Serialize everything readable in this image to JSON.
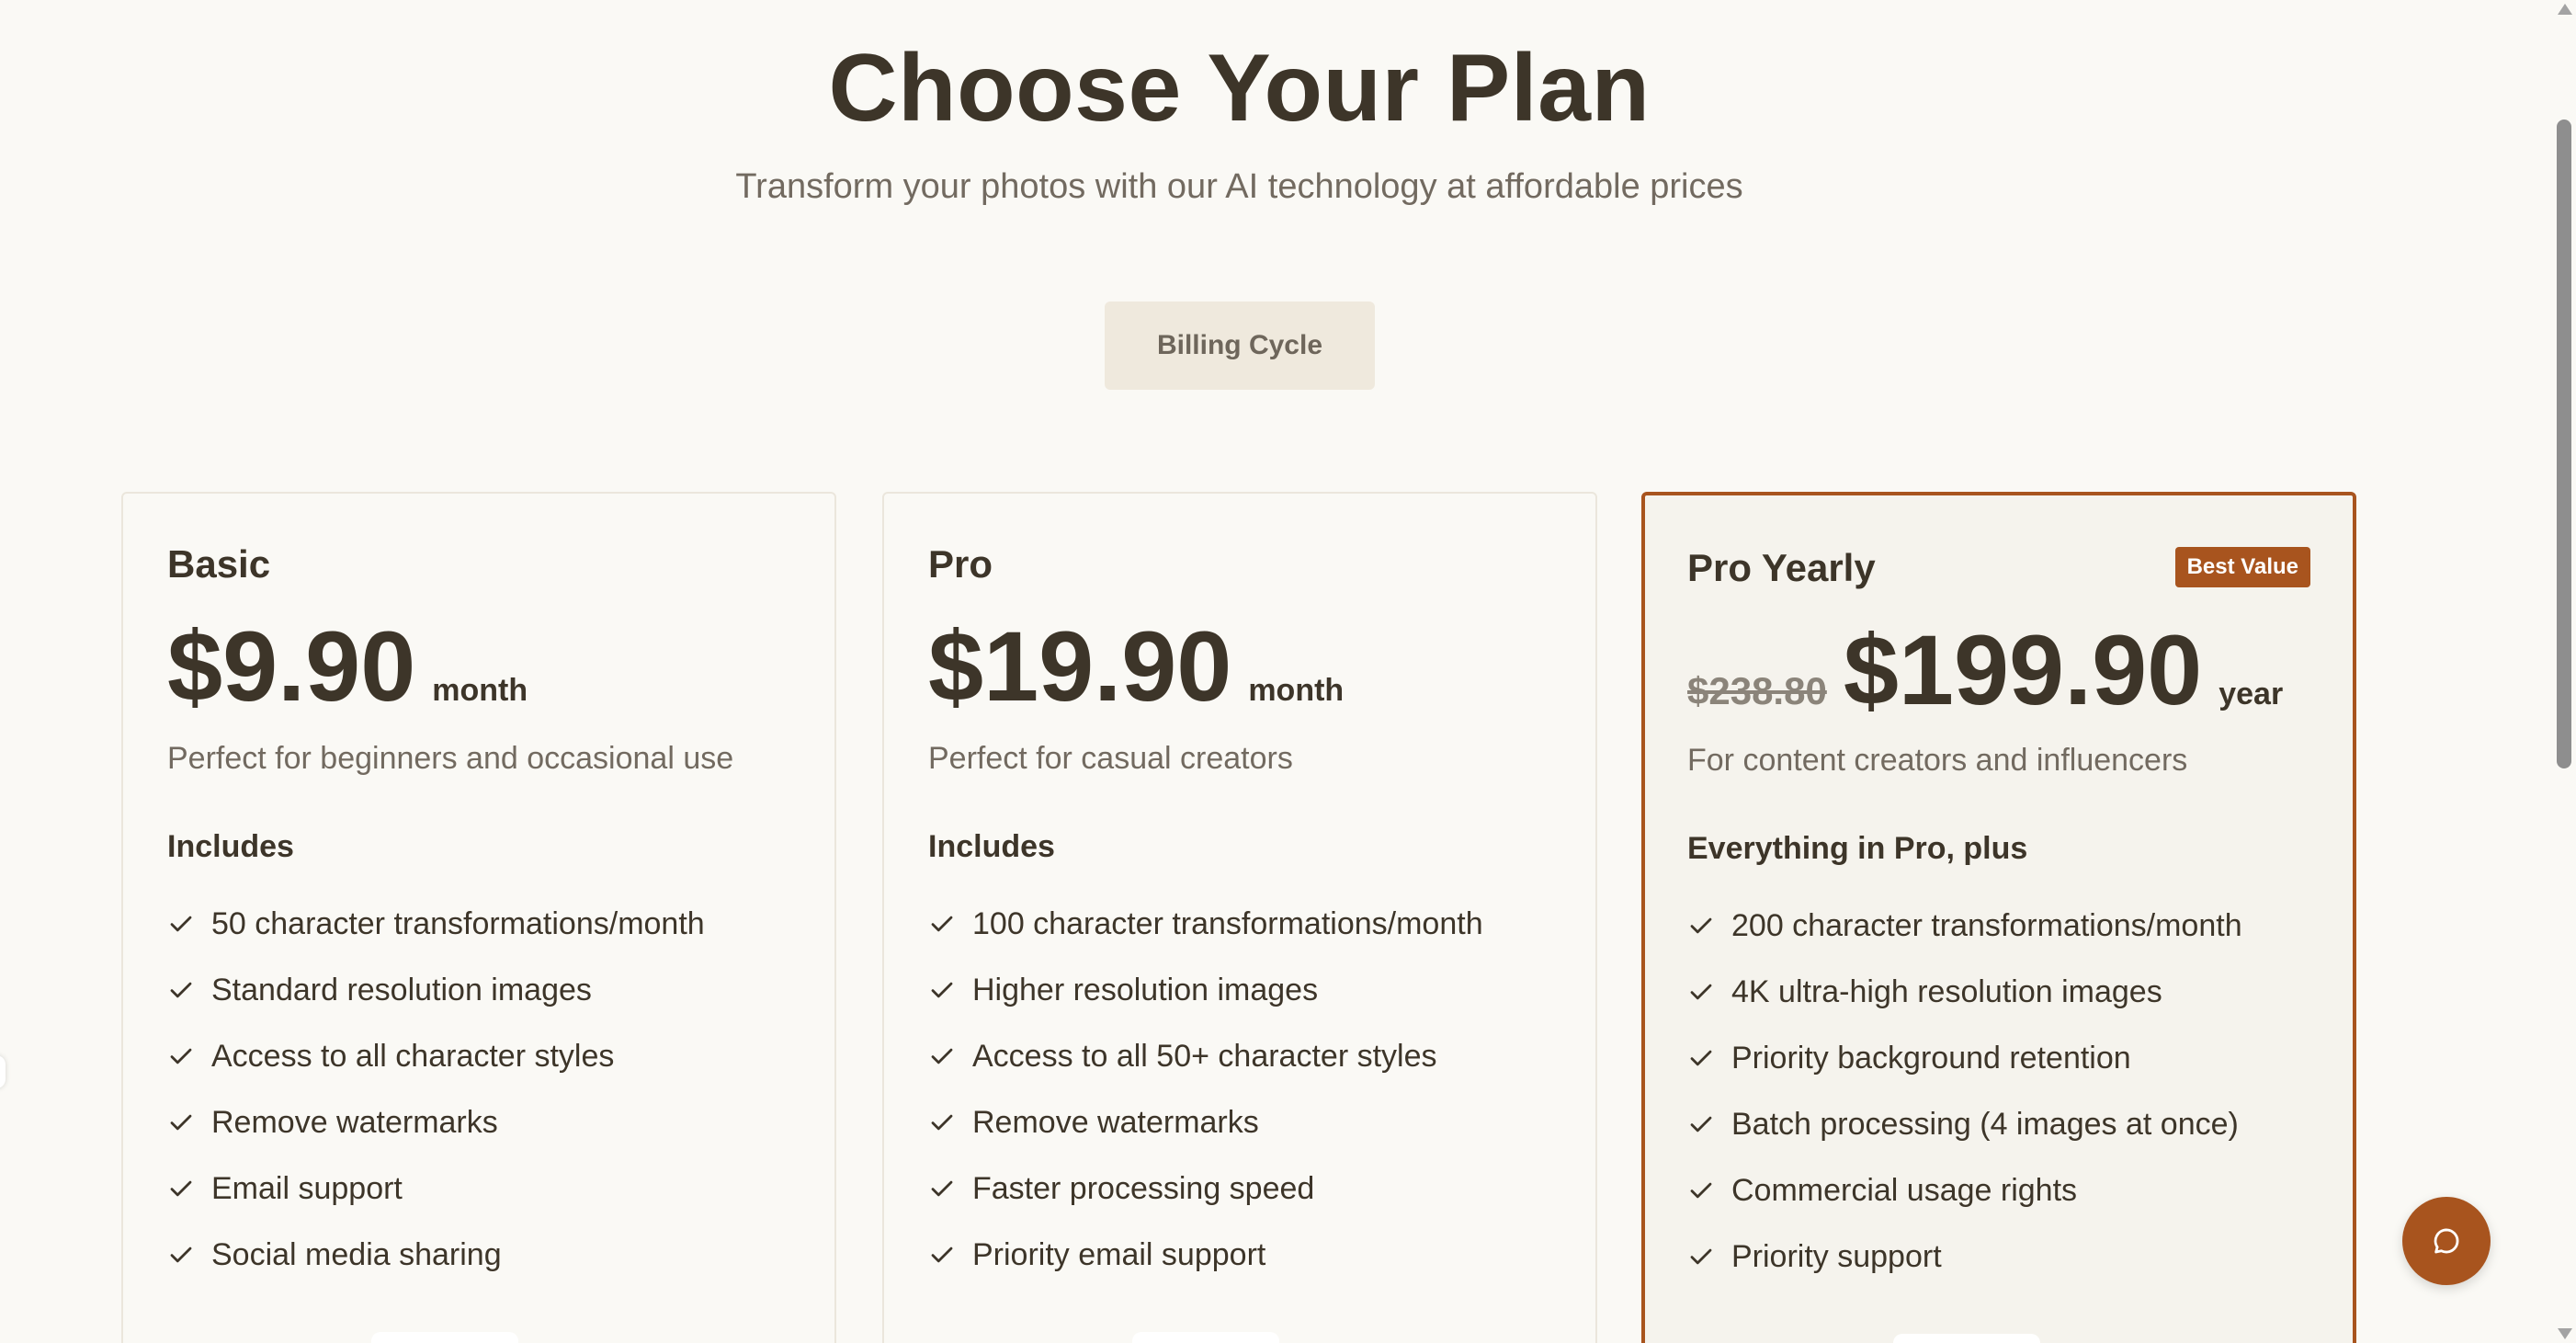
{
  "header": {
    "title": "Choose Your Plan",
    "subtitle": "Transform your photos with our AI technology at affordable prices"
  },
  "billing": {
    "label": "Billing Cycle"
  },
  "plans": [
    {
      "name": "Basic",
      "price": "$9.90",
      "period": "month",
      "description": "Perfect for beginners and occasional use",
      "includes_label": "Includes",
      "features": [
        "50 character transformations/month",
        "Standard resolution images",
        "Access to all character styles",
        "Remove watermarks",
        "Email support",
        "Social media sharing"
      ]
    },
    {
      "name": "Pro",
      "price": "$19.90",
      "period": "month",
      "description": "Perfect for casual creators",
      "includes_label": "Includes",
      "features": [
        "100 character transformations/month",
        "Higher resolution images",
        "Access to all 50+ character styles",
        "Remove watermarks",
        "Faster processing speed",
        "Priority email support"
      ]
    },
    {
      "name": "Pro Yearly",
      "badge": "Best Value",
      "old_price": "$238.80",
      "price": "$199.90",
      "period": "year",
      "description": "For content creators and influencers",
      "includes_label": "Everything in Pro, plus",
      "features": [
        "200 character transformations/month",
        "4K ultra-high resolution images",
        "Priority background retention",
        "Batch processing (4 images at once)",
        "Commercial usage rights",
        "Priority support"
      ]
    }
  ],
  "icons": {
    "feature": "check-icon",
    "chat": "chat-bubble-icon"
  },
  "colors": {
    "accent": "#a8541e",
    "text": "#3d3529",
    "muted": "#726a60",
    "background": "#faf9f5",
    "billing_button": "#efe9dd"
  }
}
